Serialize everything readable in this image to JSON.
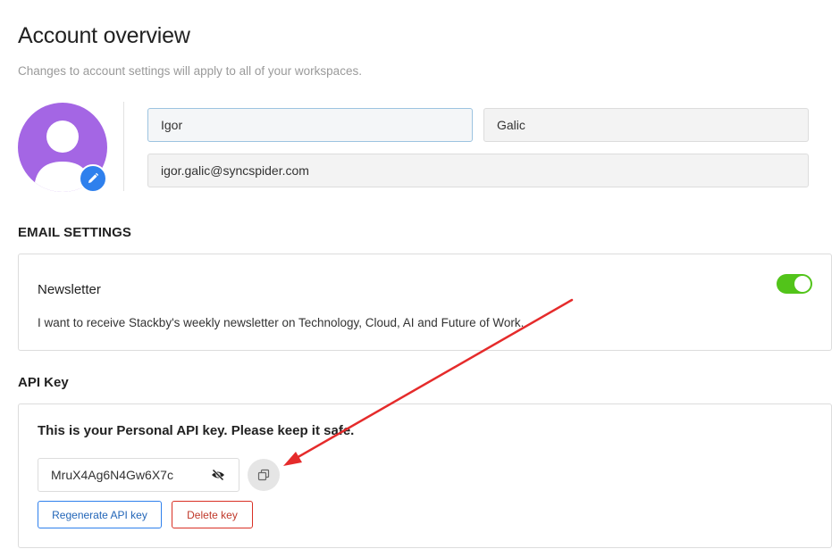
{
  "page": {
    "title": "Account overview",
    "subtitle": "Changes to account settings will apply to all of your workspaces."
  },
  "profile": {
    "first_name": "Igor",
    "last_name": "Galic",
    "email": "igor.galic@syncspider.com",
    "avatar_color": "#a466e4",
    "edit_button_color": "#2f80ed"
  },
  "email_settings": {
    "section_title": "EMAIL SETTINGS",
    "newsletter": {
      "title": "Newsletter",
      "description": "I want to receive Stackby's weekly newsletter on Technology, Cloud, AI and Future of Work.",
      "enabled": true,
      "toggle_color": "#52c41a"
    }
  },
  "api": {
    "section_title": "API Key",
    "heading": "This is your Personal API key. Please keep it safe.",
    "key_value": "MruX4Ag6N4Gw6X7c",
    "regenerate_label": "Regenerate API key",
    "delete_label": "Delete key",
    "icons": {
      "visibility": "eye-slash-icon",
      "copy": "copy-icon"
    }
  },
  "annotation": {
    "arrow_color": "#e52b2b"
  }
}
